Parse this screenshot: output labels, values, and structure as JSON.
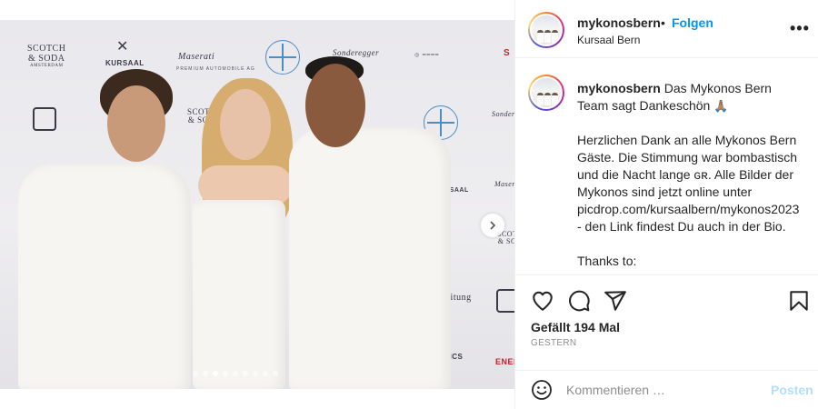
{
  "photo": {
    "sponsor_logos": {
      "scotch_soda": [
        "SCOTCH",
        "& SODA",
        "AMSTERDAM"
      ],
      "kursaal": "KURSAAL",
      "maserati": "Maserati",
      "maserati_sub": "PREMIUM AUTOMOBILE AG",
      "sonderegger": "Sonderegger",
      "zeitung": "Zeitung",
      "kanics": "ANICS"
    },
    "carousel_dots": 9,
    "active_dot": 2
  },
  "header": {
    "username": "mykonosbern",
    "separator": "•",
    "follow_label": "Folgen",
    "location": "Kursaal Bern",
    "more_label": "•••"
  },
  "caption": {
    "username": "mykonosbern",
    "first_line": "Das Mykonos Bern Team sagt Dankeschön",
    "first_emoji": "🙏🏽",
    "body": "Herzlichen Dank an alle Mykonos Bern Gäste. Die Stimmung war bombastisch und die Nacht lange ɢʀ. Alle Bilder der Mykonos sind jetzt online unter picdrop.com/kursaalbern/mykonos2023 - den Link findest Du auch in der Bio.",
    "thanks": "Thanks to:"
  },
  "actions": {
    "likes": "Gefällt 194 Mal",
    "date": "GESTERN"
  },
  "comment": {
    "placeholder": "Kommentieren …",
    "post_label": "Posten"
  },
  "icons": [
    "heart-icon",
    "comment-icon",
    "share-icon",
    "bookmark-icon",
    "emoji-icon",
    "more-icon",
    "chevron-right-icon"
  ]
}
